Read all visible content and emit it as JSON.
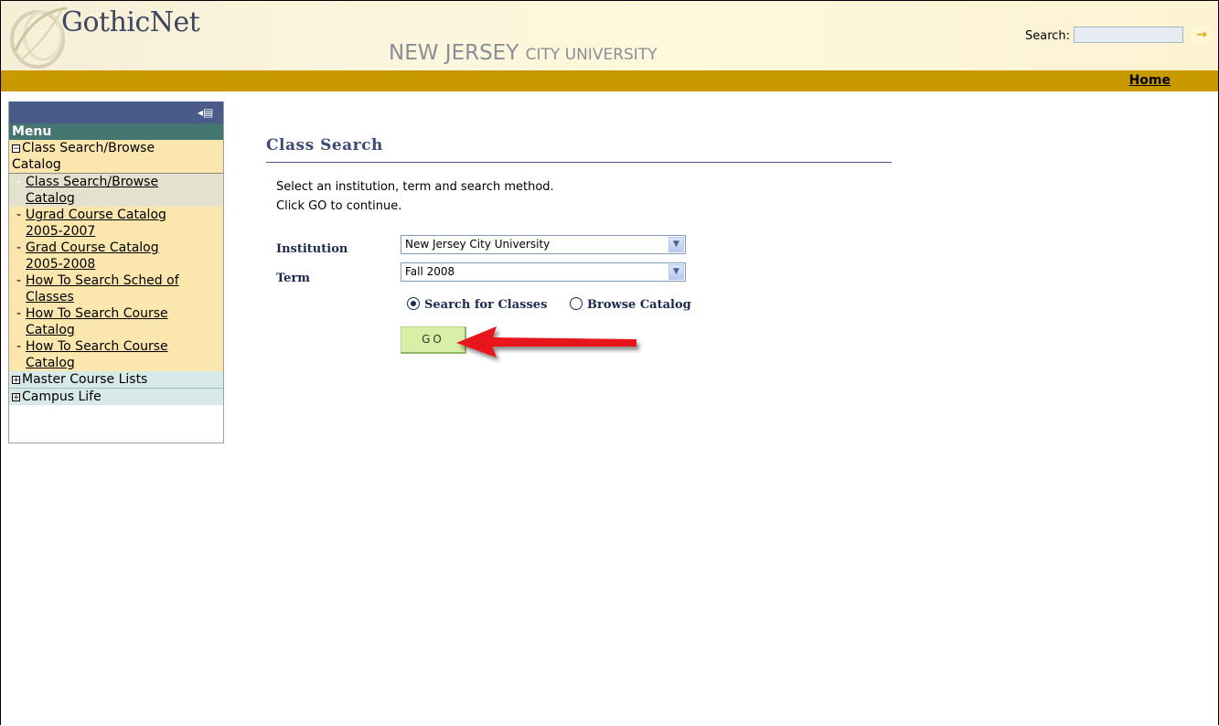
{
  "header": {
    "logo": "GothicNet",
    "university_main": "NEW JERSEY ",
    "university_small": "CITY UNIVERSITY",
    "search_label": "Search:",
    "search_value": "",
    "search_go": "→",
    "home_link": "Home"
  },
  "menu": {
    "title": "Menu",
    "open_group": {
      "label_line1": "Class Search/Browse",
      "label_line2": "Catalog",
      "items": [
        {
          "line1": "Class Search/Browse",
          "line2": "Catalog"
        },
        {
          "line1": "Ugrad Course Catalog",
          "line2": "2005-2007"
        },
        {
          "line1": "Grad Course Catalog",
          "line2": "2005-2008"
        },
        {
          "line1": "How To Search Sched of",
          "line2": "Classes"
        },
        {
          "line1": "How To Search Course",
          "line2": "Catalog"
        },
        {
          "line1": "How To Search Course",
          "line2": "Catalog"
        }
      ]
    },
    "closed_groups": [
      "Master Course Lists",
      "Campus Life"
    ]
  },
  "main": {
    "title": "Class Search",
    "instruction1": "Select an institution, term and search method.",
    "instruction2": "Click GO to continue.",
    "institution_label": "Institution",
    "institution_value": "New Jersey City University",
    "term_label": "Term",
    "term_value": "Fall 2008",
    "radio_search": "Search for Classes",
    "radio_browse": "Browse Catalog",
    "go_label": "GO"
  },
  "colors": {
    "navbar": "#c89a00",
    "menu_topbar": "#4a5b89",
    "menu_title": "#447570",
    "go_button": "#d8efa8",
    "arrow": "#e8141a"
  }
}
